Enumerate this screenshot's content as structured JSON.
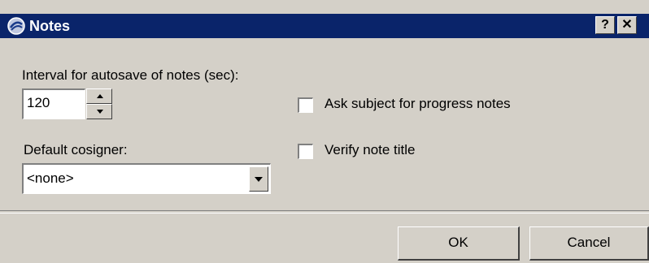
{
  "window": {
    "title": "Notes",
    "help_button": "?",
    "close_button": "✕"
  },
  "autosave": {
    "label": "Interval for autosave of notes (sec):",
    "value": "120"
  },
  "cosigner": {
    "label": "Default cosigner:",
    "selected": "<none>"
  },
  "options": {
    "ask_subject_label": "Ask subject for progress notes",
    "ask_subject_checked": false,
    "verify_title_label": "Verify note title",
    "verify_title_checked": false
  },
  "buttons": {
    "ok": "OK",
    "cancel": "Cancel"
  },
  "icons": {
    "app": "notes-app-icon",
    "spin_up": "arrow-up-icon",
    "spin_down": "arrow-down-icon",
    "dropdown": "chevron-down-icon"
  },
  "colors": {
    "titlebar": "#0a246a",
    "face": "#d4d0c8"
  }
}
